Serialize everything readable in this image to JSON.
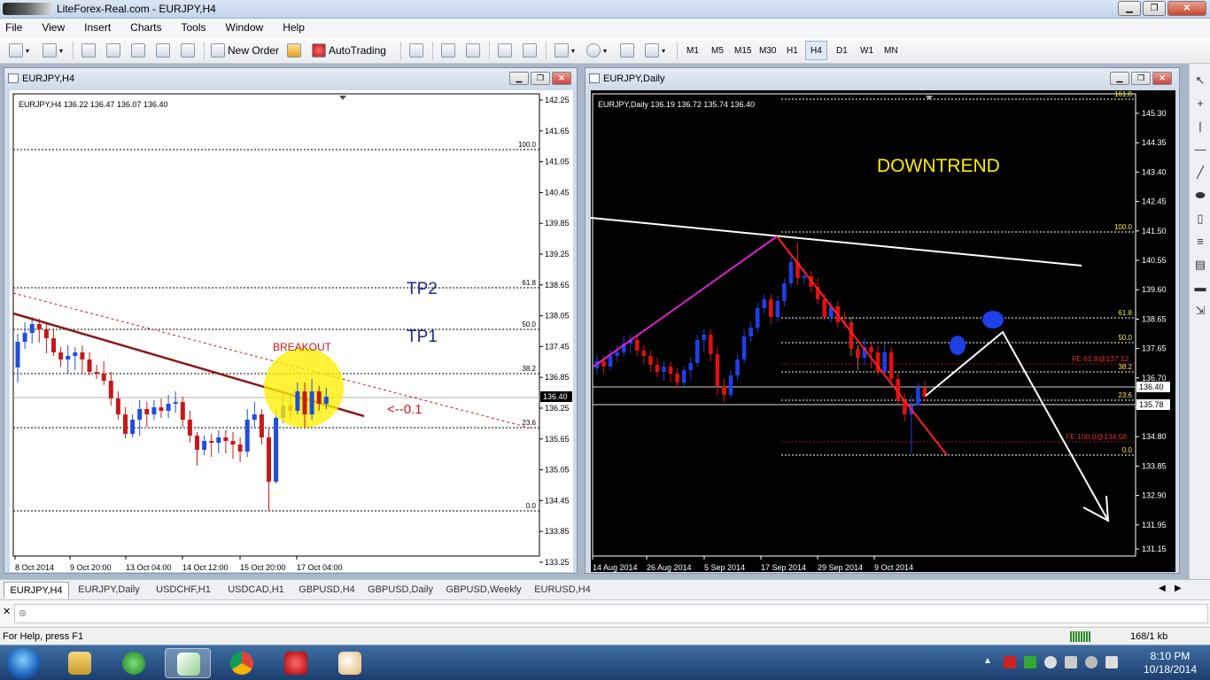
{
  "window": {
    "title": "LiteForex-Real.com - EURJPY,H4"
  },
  "menu": [
    "File",
    "View",
    "Insert",
    "Charts",
    "Tools",
    "Window",
    "Help"
  ],
  "toolbar": {
    "new_order": "New Order",
    "auto_trading": "AutoTrading",
    "timeframes": [
      "M1",
      "M5",
      "M15",
      "M30",
      "H1",
      "H4",
      "D1",
      "W1",
      "MN"
    ],
    "active_timeframe": "H4"
  },
  "left_chart": {
    "window_title": "EURJPY,H4",
    "info": "EURJPY,H4  136.22 136.47 136.07 136.40",
    "y_ticks": [
      "142.25",
      "141.65",
      "141.05",
      "140.45",
      "139.85",
      "139.25",
      "138.65",
      "138.05",
      "137.45",
      "136.85",
      "136.25",
      "135.65",
      "135.05",
      "134.45",
      "133.85",
      "133.25"
    ],
    "price_tag": "136.40",
    "fib_labels": [
      "100.0",
      "61.8",
      "50.0",
      "38.2",
      "23.6",
      "0.0"
    ],
    "x_ticks": [
      "8 Oct 2014",
      "9 Oct 20:00",
      "13 Oct 04:00",
      "14 Oct 12:00",
      "15 Oct 20:00",
      "17 Oct 04:00"
    ],
    "annotations": {
      "tp2": "TP2",
      "tp1": "TP1",
      "breakout": "BREAKOUT",
      "level": "<--0.1"
    },
    "colors": {
      "bull": "#1f4fd8",
      "bear": "#c41a1a",
      "trend": "#8b1a1a",
      "marker": "#ffee00"
    }
  },
  "right_chart": {
    "window_title": "EURJPY,Daily",
    "info": "EURJPY,Daily  136.19 136.72 135.74 136.40",
    "y_ticks": [
      "145.30",
      "144.35",
      "143.40",
      "142.45",
      "141.50",
      "140.55",
      "139.60",
      "138.65",
      "137.65",
      "136.70",
      "135.75",
      "134.80",
      "133.85",
      "132.90",
      "131.95",
      "131.15"
    ],
    "price_tag_1": "136.40",
    "price_tag_2": "135.78",
    "fib_labels": [
      "161.8",
      "100.0",
      "61.8",
      "50.0",
      "38.2",
      "23.6",
      "0.0"
    ],
    "fe_labels": [
      "FE 61.8@137.12",
      "FE 100.0@134.58"
    ],
    "x_ticks": [
      "14 Aug 2014",
      "26 Aug 2014",
      "5 Sep 2014",
      "17 Sep 2014",
      "29 Sep 2014",
      "9 Oct 2014"
    ],
    "headline": "DOWNTREND",
    "colors": {
      "bull": "#1f3fe8",
      "bear": "#e01010",
      "headline": "#ffee00",
      "upline": "#e020d0",
      "downline": "#ff2020"
    }
  },
  "tabs": [
    "EURJPY,H4",
    "EURJPY,Daily",
    "USDCHF,H1",
    "USDCAD,H1",
    "GBPUSD,H4",
    "GBPUSD,Daily",
    "GBPUSD,Weekly",
    "EURUSD,H4"
  ],
  "status": {
    "help": "For Help, press F1",
    "traffic": "168/1 kb"
  },
  "clock": {
    "time": "8:10 PM",
    "date": "10/18/2014"
  }
}
